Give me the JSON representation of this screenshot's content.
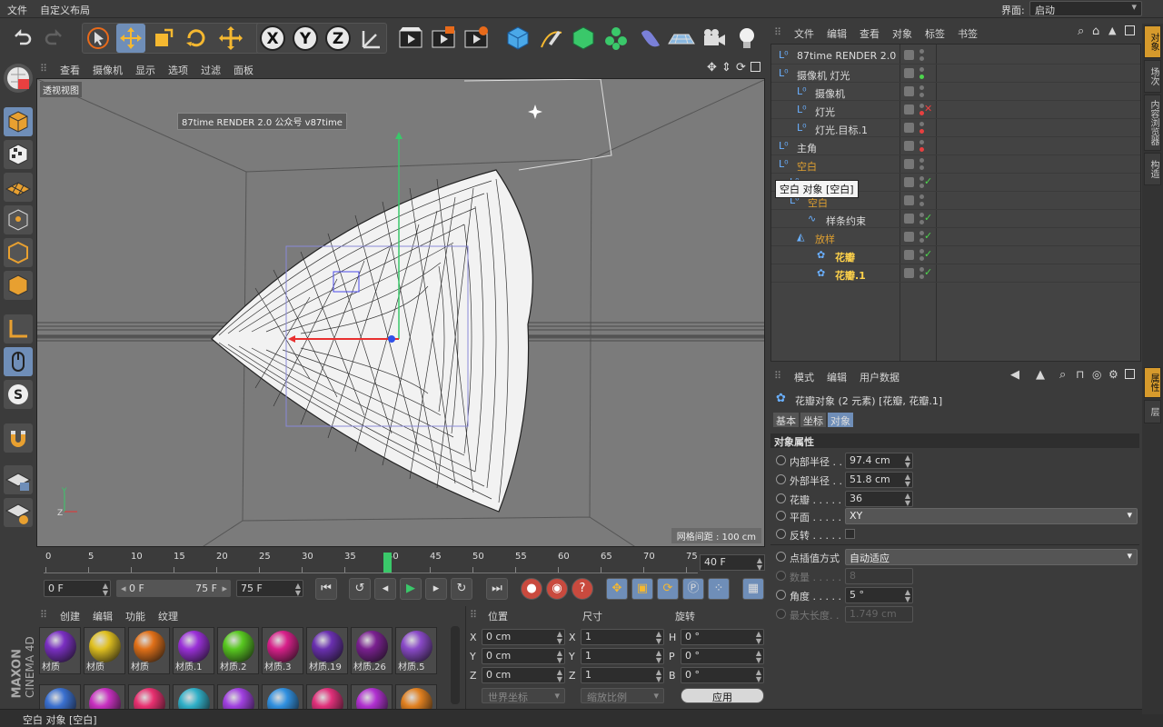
{
  "menubar": {
    "file": "文件",
    "custom_layout": "自定义布局",
    "layout_label": "界面:",
    "layout_value": "启动"
  },
  "viewport": {
    "menu": [
      "查看",
      "摄像机",
      "显示",
      "选项",
      "过滤",
      "面板"
    ],
    "view_name": "透视视图",
    "watermark": "87time RENDER 2.0  公众号 v87time",
    "grid_spacing": "网格间距 : 100 cm"
  },
  "timeline": {
    "ticks": [
      "0",
      "5",
      "10",
      "15",
      "20",
      "25",
      "30",
      "35",
      "40",
      "45",
      "50",
      "55",
      "60",
      "65",
      "70",
      "75"
    ],
    "current_frame": "40 F",
    "playhead": "40"
  },
  "transport": {
    "start": "0 F",
    "range_start": "0 F",
    "range_end": "75 F",
    "end": "75 F"
  },
  "materials": {
    "menu": [
      "创建",
      "编辑",
      "功能",
      "纹理"
    ],
    "items": [
      {
        "name": "材质",
        "color": "#7a2fc2"
      },
      {
        "name": "材质",
        "color": "#e0c020"
      },
      {
        "name": "材质",
        "color": "#e07018"
      },
      {
        "name": "材质.1",
        "color": "#9a30d8"
      },
      {
        "name": "材质.2",
        "color": "#58c820"
      },
      {
        "name": "材质.3",
        "color": "#d8208a"
      },
      {
        "name": "材质.19",
        "color": "#6a30b0"
      },
      {
        "name": "材质.26",
        "color": "#7a2090"
      },
      {
        "name": "材质.5",
        "color": "#8a4ac8"
      }
    ],
    "row2_colors": [
      "#3a70d0",
      "#c830c0",
      "#e83070",
      "#30b0c8",
      "#a040e0",
      "#3090e0",
      "#e0307a",
      "#b030d0",
      "#e08020"
    ]
  },
  "coords": {
    "headers": [
      "位置",
      "尺寸",
      "旋转"
    ],
    "rows": [
      {
        "axis": "X",
        "pos": "0 cm",
        "saxis": "X",
        "size": "1",
        "raxis": "H",
        "rot": "0 °"
      },
      {
        "axis": "Y",
        "pos": "0 cm",
        "saxis": "Y",
        "size": "1",
        "raxis": "P",
        "rot": "0 °"
      },
      {
        "axis": "Z",
        "pos": "0 cm",
        "saxis": "Z",
        "size": "1",
        "raxis": "B",
        "rot": "0 °"
      }
    ],
    "world": "世界坐标",
    "scale": "缩放比例",
    "apply": "应用"
  },
  "status": "空白 对象 [空白]",
  "objects": {
    "menu": [
      "文件",
      "编辑",
      "查看",
      "对象",
      "标签",
      "书签"
    ],
    "tooltip": "空白 对象 [空白]",
    "rows": [
      {
        "name": "87time RENDER 2.0",
        "style": ""
      },
      {
        "name": "摄像机 灯光",
        "style": ""
      },
      {
        "name": "摄像机",
        "style": ""
      },
      {
        "name": "灯光",
        "style": ""
      },
      {
        "name": "灯光.目标.1",
        "style": ""
      },
      {
        "name": "主角",
        "style": ""
      },
      {
        "name": "空白",
        "style": "or"
      },
      {
        "name": "",
        "style": ""
      },
      {
        "name": "空白",
        "style": "or"
      },
      {
        "name": "样条约束",
        "style": ""
      },
      {
        "name": "放样",
        "style": "or"
      },
      {
        "name": "花瓣",
        "style": "yl"
      },
      {
        "name": "花瓣.1",
        "style": "yl"
      }
    ]
  },
  "right_tabs": [
    "对象",
    "场次",
    "内容浏览器",
    "构造"
  ],
  "right_tabs2": [
    "属性",
    "层"
  ],
  "attributes": {
    "menu": [
      "模式",
      "编辑",
      "用户数据"
    ],
    "title": "花瓣对象 (2 元素) [花瓣, 花瓣.1]",
    "tabs": [
      "基本",
      "坐标",
      "对象"
    ],
    "section": "对象属性",
    "inner_radius_label": "内部半径 . .",
    "inner_radius": "97.4 cm",
    "outer_radius_label": "外部半径 . .",
    "outer_radius": "51.8 cm",
    "petals_label": "花瓣 . . . . .",
    "petals": "36",
    "plane_label": "平面 . . . . .",
    "plane": "XY",
    "reverse_label": "反转 . . . . .",
    "interp_label": "点插值方式",
    "interp": "自动适应",
    "count_label": "数量 . . . . .",
    "count": "8",
    "angle_label": "角度 . . . . .",
    "angle": "5 °",
    "maxlen_label": "最大长度. .",
    "maxlen": "1.749 cm"
  },
  "brand": {
    "maxon": "MAXON",
    "product": "CINEMA 4D"
  }
}
